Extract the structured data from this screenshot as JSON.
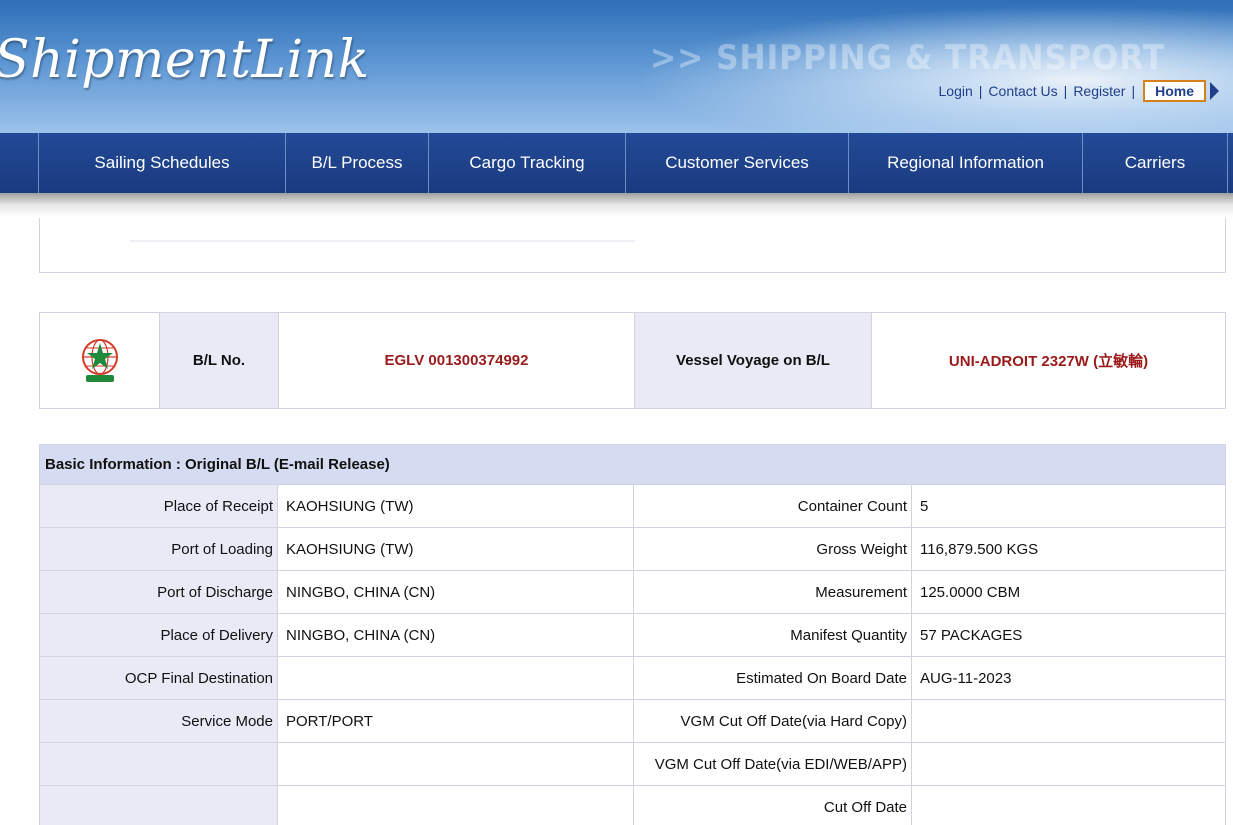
{
  "header": {
    "logo_text": "ShipmentLink",
    "tagline": ">> SHIPPING & TRANSPORT",
    "links": {
      "login": "Login",
      "contact": "Contact Us",
      "register": "Register",
      "home": "Home",
      "separator": "|"
    }
  },
  "nav": {
    "items": [
      {
        "label": "Sailing Schedules"
      },
      {
        "label": "B/L Process"
      },
      {
        "label": "Cargo Tracking"
      },
      {
        "label": "Customer Services"
      },
      {
        "label": "Regional Information"
      },
      {
        "label": "Carriers"
      }
    ]
  },
  "bl": {
    "bl_no_label": "B/L No.",
    "bl_no_value": "EGLV 001300374992",
    "vessel_label": "Vessel Voyage on B/L",
    "vessel_value": "UNI-ADROIT 2327W (立敏輪)"
  },
  "basic_info": {
    "title": "Basic Information : Original B/L (E-mail Release)",
    "rows": [
      {
        "l1": "Place of Receipt",
        "v1": "KAOHSIUNG (TW)",
        "l2": "Container Count",
        "v2": "5"
      },
      {
        "l1": "Port of Loading",
        "v1": "KAOHSIUNG (TW)",
        "l2": "Gross Weight",
        "v2": "116,879.500 KGS"
      },
      {
        "l1": "Port of Discharge",
        "v1": "NINGBO, CHINA (CN)",
        "l2": "Measurement",
        "v2": "125.0000 CBM"
      },
      {
        "l1": "Place of Delivery",
        "v1": "NINGBO, CHINA (CN)",
        "l2": "Manifest Quantity",
        "v2": "57 PACKAGES"
      },
      {
        "l1": "OCP Final Destination",
        "v1": "",
        "l2": "Estimated On Board Date",
        "v2": "AUG-11-2023"
      },
      {
        "l1": "Service Mode",
        "v1": "PORT/PORT",
        "l2": "VGM Cut Off Date(via Hard Copy)",
        "v2": ""
      },
      {
        "l1": "",
        "v1": "",
        "l2": "VGM Cut Off Date(via EDI/WEB/APP)",
        "v2": ""
      },
      {
        "l1": "",
        "v1": "",
        "l2": "Cut Off Date",
        "v2": ""
      }
    ]
  },
  "colors": {
    "nav_bg": "#1a3a7e",
    "label_bg": "#e8ebf6",
    "header_bg": "#d5dcf2",
    "value_red": "#9b1b1b",
    "home_border": "#d7801e"
  },
  "icons": {
    "carrier_logo": "evergreen-globe-logo-icon",
    "home_arrow": "home-arrow-icon"
  }
}
